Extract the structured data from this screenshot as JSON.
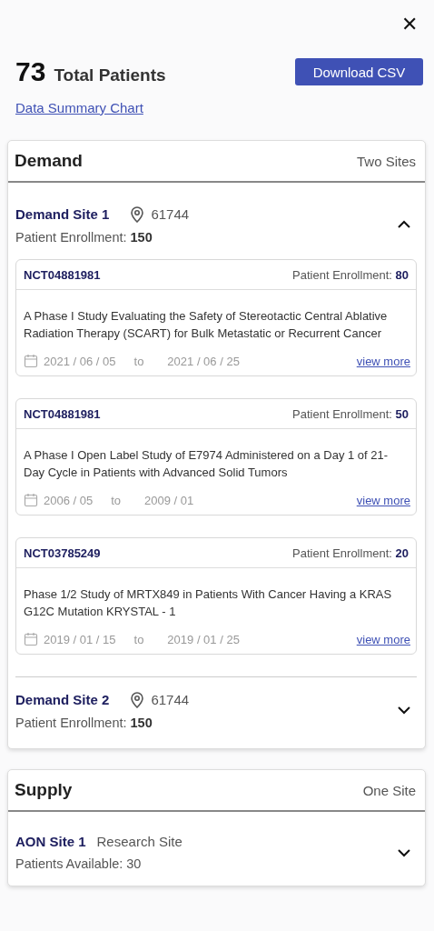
{
  "close_label": "✕",
  "summary": {
    "count": "73",
    "label": "Total Patients",
    "download": "Download CSV",
    "chart_link": "Data Summary Chart"
  },
  "sections": [
    {
      "title": "Demand",
      "count": "Two Sites",
      "sites": [
        {
          "kind": "demand",
          "name": "Demand Site 1",
          "zip": "61744",
          "detail": "Patient Enrollment: **150**",
          "expanded": true,
          "trials": [
            {
              "id": "NCT04881981",
              "enrollment": "Patient Enrollment: **80**",
              "title": "A Phase I Study Evaluating the Safety of Stereotactic Central Ablative Radiation Therapy (SCART) for Bulk Metastatic or Recurrent Cancer",
              "start": "2021 / 06 / 05",
              "to": "to",
              "end": "2021 / 06 / 25",
              "link": "view more"
            },
            {
              "id": "NCT04881981",
              "enrollment": "Patient Enrollment: **50**",
              "title": "A Phase I Open Label Study of E7974 Administered on a Day 1 of 21-Day Cycle in Patients with Advanced Solid Tumors",
              "start": "2006 / 05",
              "to": "to",
              "end": "2009 / 01",
              "link": "view more"
            },
            {
              "id": "NCT03785249",
              "enrollment": "Patient Enrollment: **20**",
              "title": "Phase 1/2 Study of MRTX849 in Patients With Cancer Having a KRAS G12C Mutation KRYSTAL - 1",
              "start": "2019 / 01 / 15",
              "to": "to",
              "end": "2019 / 01 / 25",
              "link": "view more"
            }
          ]
        },
        {
          "kind": "demand",
          "name": "Demand Site 2",
          "zip": "61744",
          "detail": "Patient Enrollment: **150**",
          "expanded": false
        }
      ]
    },
    {
      "title": "Supply",
      "count": "One Site",
      "sites": [
        {
          "kind": "supply",
          "name": "AON Site 1",
          "subtitle": "Research Site",
          "detail": "Patients Available: 30",
          "expanded": false
        }
      ]
    }
  ]
}
